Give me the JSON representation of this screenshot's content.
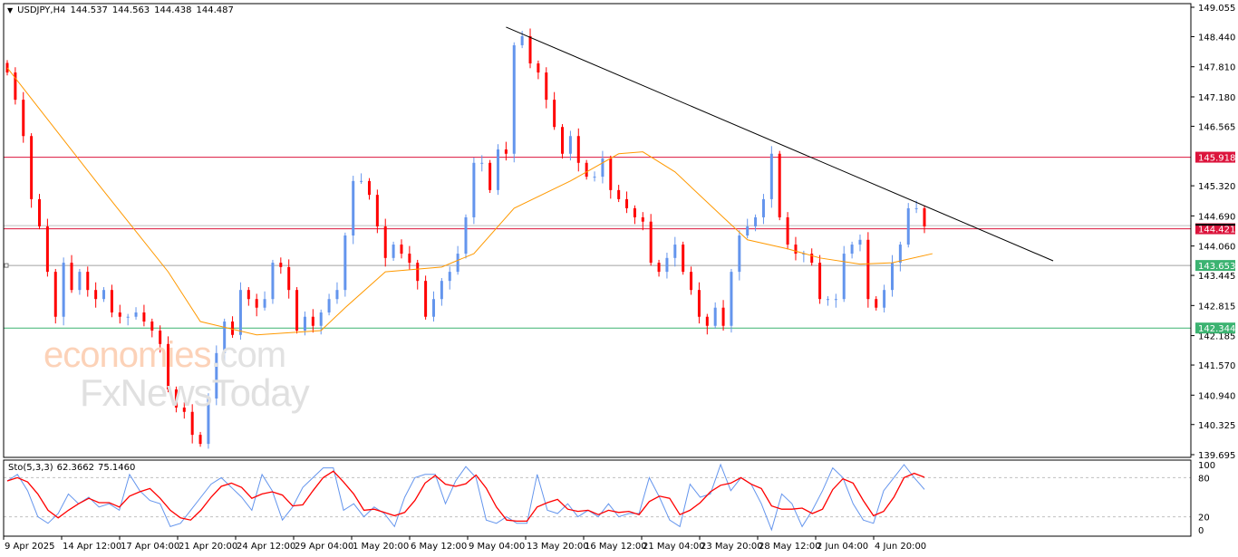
{
  "header": {
    "symbol": "USDJPY,H4",
    "open": "144.537",
    "high": "144.563",
    "low": "144.438",
    "close": "144.487",
    "menu_icon": "triangle-down-icon"
  },
  "watermark": {
    "part1": "economies",
    "part2": ".com",
    "line2": "FxNewsToday"
  },
  "stochastic": {
    "label": "Sto(5,3,3)",
    "main": "62.3662",
    "signal": "75.1460",
    "levels": [
      "100",
      "80",
      "20",
      "0"
    ]
  },
  "colors": {
    "bull": "#6495ED",
    "bear": "#FF0000",
    "ma": "#FF9900",
    "trend": "#000000",
    "resistance": "#DC143C",
    "support": "#3CB371",
    "sto_main": "#6495ED",
    "sto_signal": "#FF0000"
  },
  "chart_data": {
    "type": "candlestick",
    "title": "USDJPY,H4",
    "ylim": [
      139.695,
      149.055
    ],
    "price_ticks": [
      "149.055",
      "148.440",
      "147.810",
      "147.180",
      "146.565",
      "145.320",
      "144.690",
      "144.060",
      "143.445",
      "142.815",
      "142.185",
      "141.570",
      "140.940",
      "140.325",
      "139.695"
    ],
    "time_ticks": [
      "9 Apr 2025",
      "14 Apr 12:00",
      "17 Apr 04:00",
      "21 Apr 20:00",
      "24 Apr 12:00",
      "29 Apr 04:00",
      "1 May 20:00",
      "6 May 12:00",
      "9 May 04:00",
      "13 May 20:00",
      "16 May 12:00",
      "21 May 04:00",
      "23 May 20:00",
      "28 May 12:00",
      "2 Jun 04:00",
      "4 Jun 20:00"
    ],
    "closes": [
      147.69,
      147.12,
      146.36,
      145.04,
      144.47,
      143.52,
      142.58,
      143.71,
      143.14,
      143.52,
      143.14,
      142.95,
      143.14,
      142.67,
      142.58,
      142.58,
      142.67,
      142.48,
      142.29,
      142.01,
      141.06,
      140.68,
      140.59,
      140.11,
      139.92,
      140.87,
      141.82,
      142.48,
      142.2,
      143.14,
      142.95,
      142.77,
      142.95,
      143.71,
      143.62,
      143.14,
      142.29,
      142.58,
      142.39,
      142.67,
      142.95,
      143.14,
      144.28,
      145.42,
      145.42,
      145.13,
      144.47,
      143.81,
      144.09,
      143.9,
      143.71,
      143.33,
      142.58,
      142.95,
      143.33,
      143.52,
      143.9,
      144.66,
      145.8,
      145.8,
      145.23,
      146.08,
      145.99,
      148.26,
      148.45,
      147.88,
      147.69,
      147.12,
      146.55,
      145.99,
      146.36,
      145.8,
      145.51,
      145.51,
      145.89,
      145.23,
      145.04,
      144.85,
      144.66,
      144.57,
      143.71,
      143.52,
      143.81,
      144.09,
      143.52,
      143.14,
      142.58,
      142.39,
      142.77,
      142.39,
      143.52,
      144.28,
      144.47,
      144.66,
      145.04,
      145.99,
      144.66,
      144.09,
      143.9,
      143.9,
      143.71,
      142.95,
      142.95,
      142.95,
      143.9,
      144.09,
      144.19,
      142.95,
      142.77,
      143.14,
      143.71,
      144.09,
      144.85,
      144.85,
      144.47
    ],
    "moving_average": [
      [
        0,
        147.79
      ],
      [
        11,
        145.42
      ],
      [
        20,
        143.52
      ],
      [
        24,
        142.48
      ],
      [
        31,
        142.2
      ],
      [
        39,
        142.29
      ],
      [
        42,
        142.77
      ],
      [
        47,
        143.52
      ],
      [
        54,
        143.62
      ],
      [
        58,
        143.9
      ],
      [
        63,
        144.85
      ],
      [
        70,
        145.42
      ],
      [
        76,
        145.99
      ],
      [
        79,
        146.03
      ],
      [
        83,
        145.61
      ],
      [
        89,
        144.66
      ],
      [
        92,
        144.19
      ],
      [
        97,
        144.0
      ],
      [
        101,
        143.81
      ],
      [
        106,
        143.68
      ],
      [
        110,
        143.71
      ],
      [
        115,
        143.9
      ]
    ],
    "trendline": [
      [
        62,
        148.64
      ],
      [
        130,
        143.75
      ]
    ],
    "levels": [
      {
        "label": "145.918",
        "value": 145.918,
        "kind": "resistance"
      },
      {
        "label": "144.421",
        "value": 144.421,
        "kind": "resistance"
      },
      {
        "label": "143.653",
        "value": 143.653,
        "kind": "support"
      },
      {
        "label": "142.344",
        "value": 142.344,
        "kind": "support"
      }
    ],
    "current_price": 144.487,
    "stochastic_k": [
      75,
      85,
      60,
      20,
      10,
      25,
      55,
      40,
      50,
      35,
      40,
      30,
      85,
      60,
      45,
      40,
      5,
      10,
      30,
      50,
      70,
      80,
      65,
      50,
      30,
      85,
      60,
      15,
      35,
      65,
      80,
      95,
      95,
      30,
      40,
      20,
      35,
      25,
      5,
      50,
      80,
      85,
      85,
      40,
      75,
      97,
      80,
      15,
      10,
      20,
      10,
      10,
      85,
      30,
      25,
      40,
      20,
      30,
      20,
      40,
      20,
      25,
      25,
      80,
      50,
      15,
      5,
      70,
      50,
      55,
      100,
      60,
      80,
      70,
      40,
      0,
      55,
      40,
      5,
      30,
      60,
      95,
      80,
      40,
      15,
      10,
      60,
      80,
      100,
      80,
      62
    ]
  }
}
